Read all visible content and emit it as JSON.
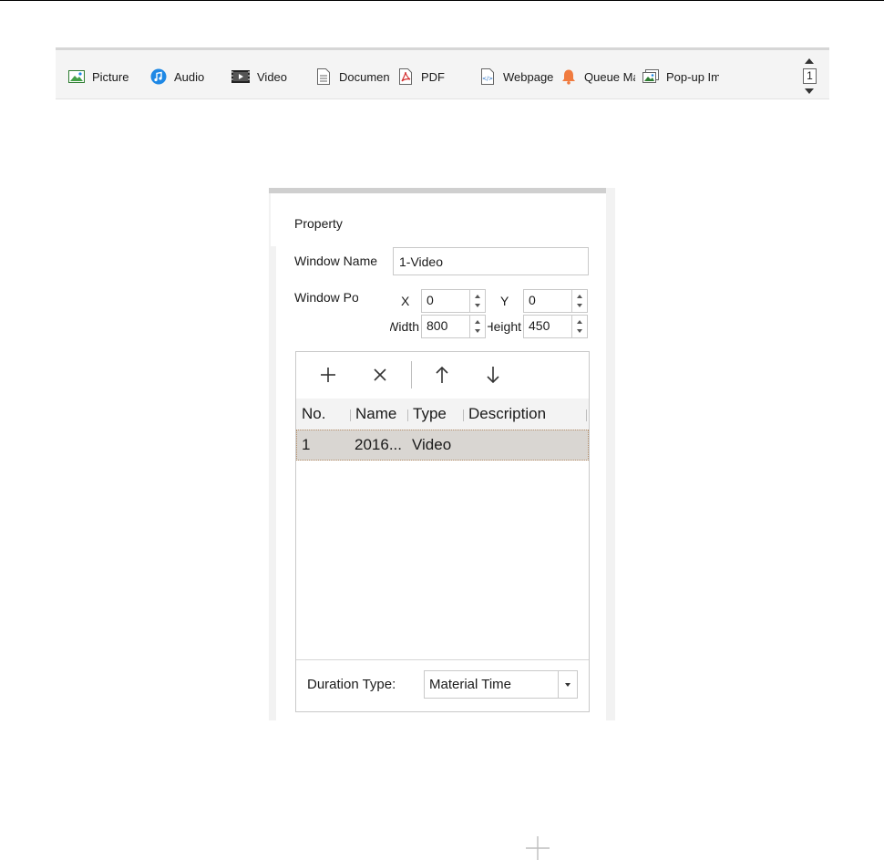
{
  "toolbar": {
    "items": [
      {
        "label": "Picture",
        "icon": "picture-icon"
      },
      {
        "label": "Audio",
        "icon": "audio-icon"
      },
      {
        "label": "Video",
        "icon": "video-icon"
      },
      {
        "label": "Document",
        "icon": "document-icon"
      },
      {
        "label": "PDF",
        "icon": "pdf-icon"
      },
      {
        "label": "Webpage",
        "icon": "webpage-icon"
      },
      {
        "label": "Queue Management",
        "icon": "bell-icon"
      },
      {
        "label": "Pop-up Image",
        "icon": "popup-image-icon"
      }
    ],
    "page": "1"
  },
  "property": {
    "heading": "Property",
    "window_name_label": "Window Name",
    "window_name_value": "1-Video",
    "window_pos_label": "Window Position",
    "x_label": "X",
    "x_value": "0",
    "y_label": "Y",
    "y_value": "0",
    "width_label": "Width",
    "width_value": "800",
    "height_label": "Height",
    "height_value": "450"
  },
  "materials": {
    "columns": [
      "No.",
      "Name",
      "Type",
      "Description"
    ],
    "rows": [
      {
        "no": "1",
        "name": "2016...",
        "type": "Video",
        "description": ""
      }
    ],
    "duration_label": "Duration Type:",
    "duration_value": "Material Time"
  },
  "colors": {
    "selected_row": "#d9d6d2",
    "bell": "#f07b3f"
  }
}
